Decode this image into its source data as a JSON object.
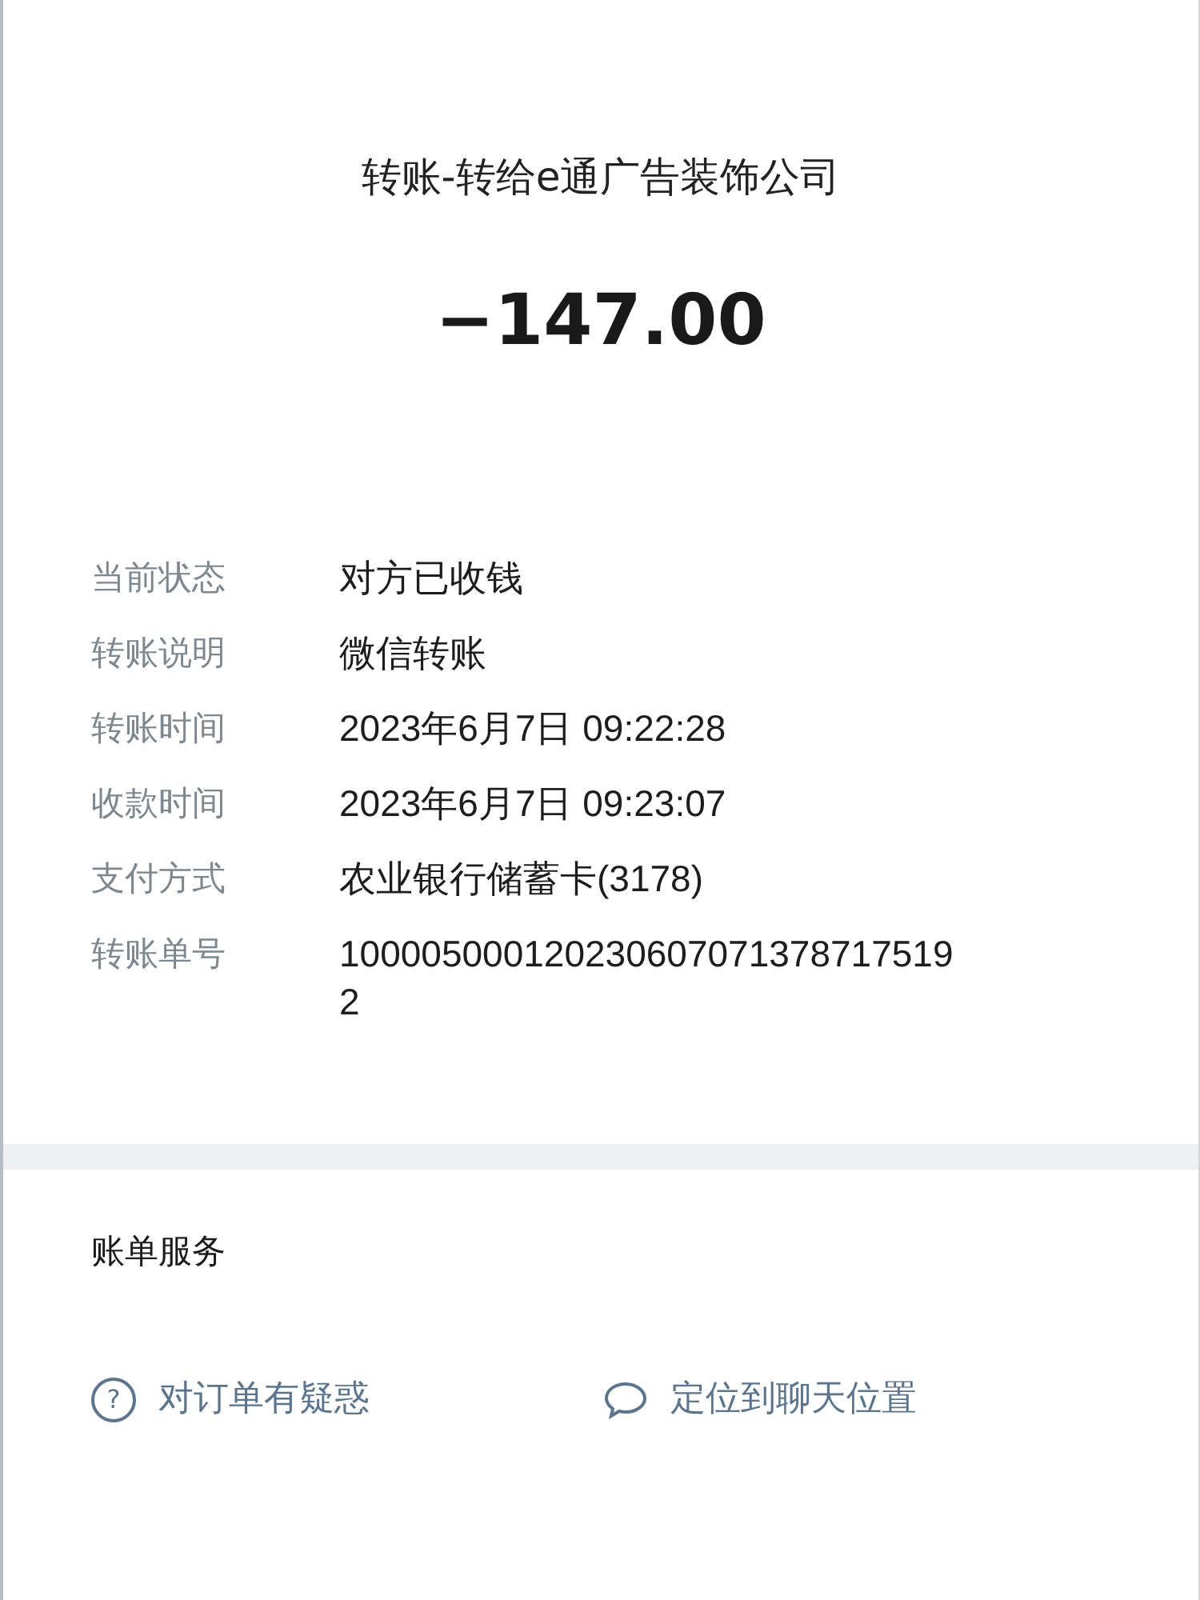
{
  "title": "转账-转给e通广告装饰公司",
  "amount": "−147.00",
  "details": [
    {
      "label": "当前状态",
      "value": "对方已收钱"
    },
    {
      "label": "转账说明",
      "value": "微信转账"
    },
    {
      "label": "转账时间",
      "value": "2023年6月7日 09:22:28"
    },
    {
      "label": "收款时间",
      "value": "2023年6月7日 09:23:07"
    },
    {
      "label": "支付方式",
      "value": "农业银行储蓄卡(3178)"
    },
    {
      "label": "转账单号",
      "value": "100005000120230607071378717519 2"
    }
  ],
  "services": {
    "title": "账单服务",
    "actions": [
      {
        "kind": "question",
        "glyph": "?",
        "label": "对订单有疑惑"
      },
      {
        "kind": "chat",
        "label": "定位到聊天位置"
      }
    ]
  }
}
